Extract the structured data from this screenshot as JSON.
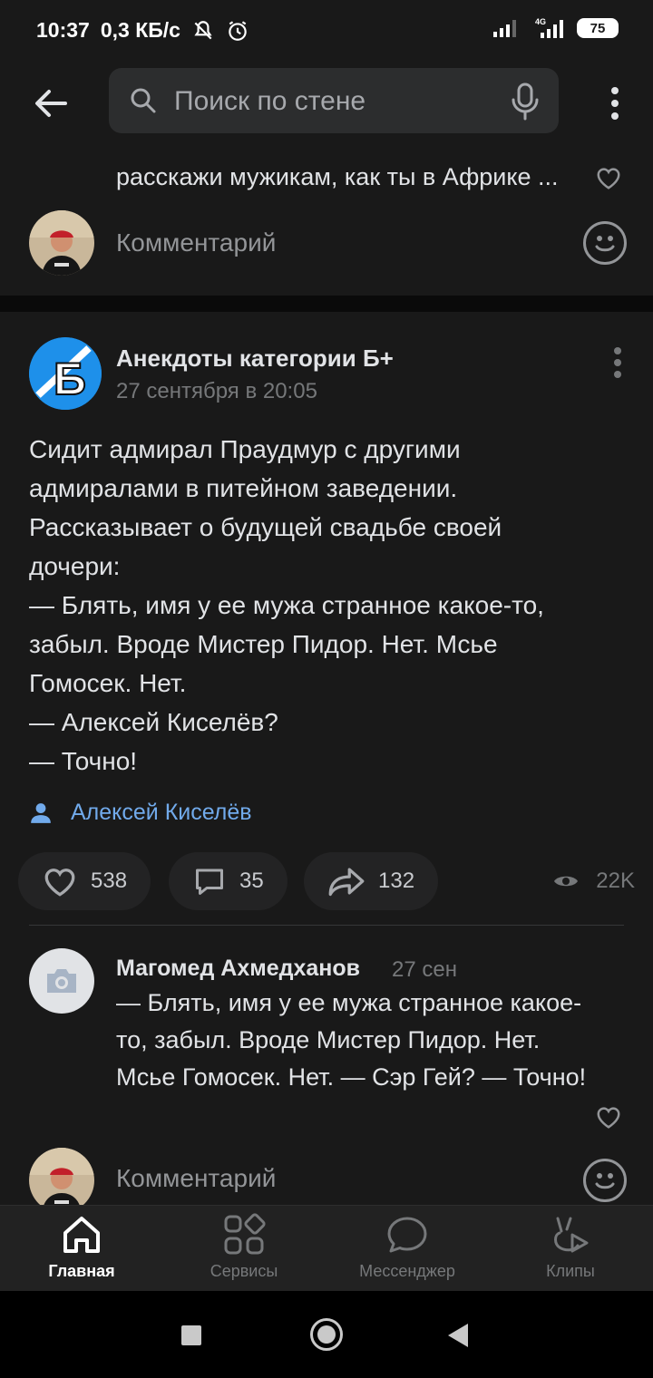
{
  "status_bar": {
    "time": "10:37",
    "speed": "0,3 КБ/с",
    "network": "4G",
    "battery": "75"
  },
  "search": {
    "placeholder": "Поиск по стене"
  },
  "previous_comment": {
    "text": "расскажи мужикам, как ты в Африке ...",
    "comment_placeholder": "Комментарий"
  },
  "post": {
    "group_name": "Анекдоты категории Б+",
    "group_avatar_letter": "Б",
    "date": "27 сентября в 20:05",
    "text": "Сидит адмирал Праудмур с другими\nадмиралами в питейном заведении.\nРассказывает о будущей свадьбе своей\nдочери:\n— Блять, имя у ее мужа странное какое-то,\nзабыл. Вроде Мистер Пидор. Нет. Мсье\nГомосек. Нет.\n— Алексей Киселёв?\n— Точно!",
    "mention": "Алексей Киселёв",
    "likes": "538",
    "comments": "35",
    "shares": "132",
    "views": "22K"
  },
  "comment": {
    "author": "Магомед Ахмедханов",
    "date": "27 сен",
    "text": "— Блять, имя у ее мужа странное какое-то, забыл. Вроде Мистер Пидор. Нет. Мсье Гомосек. Нет. — Сэр Гей? — Точно!",
    "comment_placeholder": "Комментарий"
  },
  "tabs": [
    {
      "label": "Главная",
      "icon": "home-icon",
      "active": true
    },
    {
      "label": "Сервисы",
      "icon": "services-icon",
      "active": false
    },
    {
      "label": "Мессенджер",
      "icon": "messenger-icon",
      "active": false
    },
    {
      "label": "Клипы",
      "icon": "clips-icon",
      "active": false
    }
  ],
  "colors": {
    "background": "#191919",
    "link": "#71aaeb",
    "secondary_text": "#76787a"
  }
}
